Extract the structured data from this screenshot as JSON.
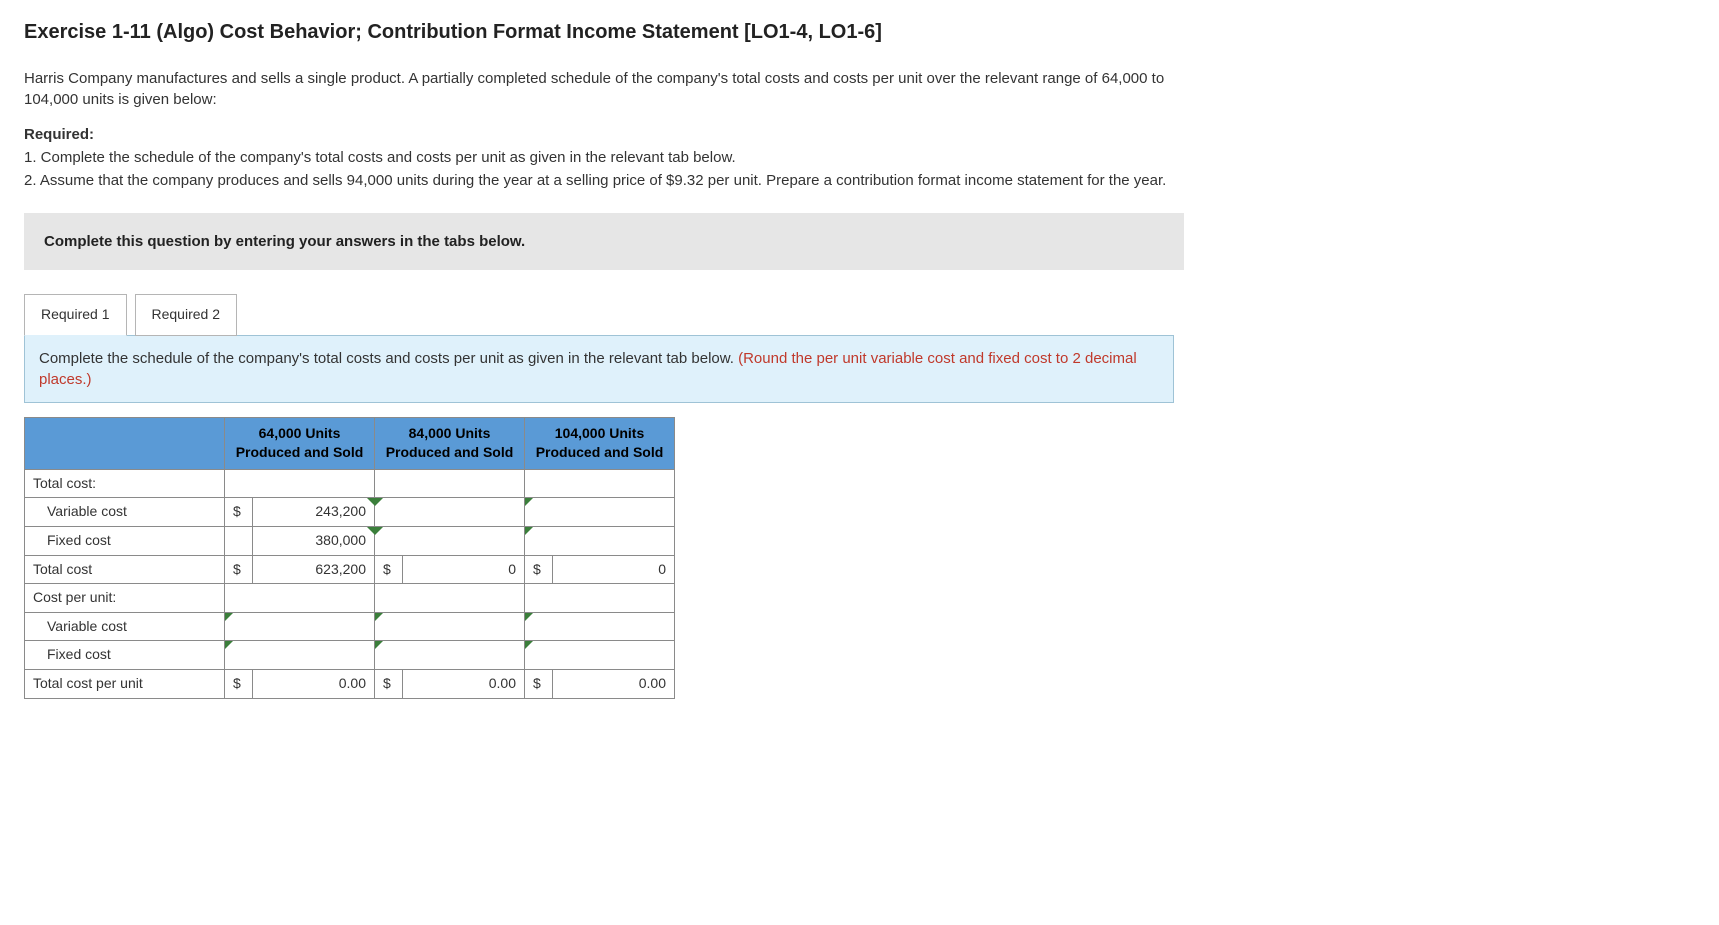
{
  "title": "Exercise 1-11 (Algo) Cost Behavior; Contribution Format Income Statement [LO1-4, LO1-6]",
  "intro": "Harris Company manufactures and sells a single product. A partially completed schedule of the company's total costs and costs per unit over the relevant range of 64,000 to 104,000 units is given below:",
  "required_label": "Required:",
  "requirements": [
    "1. Complete the schedule of the company's total costs and costs per unit as given in the relevant tab below.",
    "2. Assume that the company produces and sells 94,000 units during the year at a selling price of $9.32 per unit. Prepare a contribution format income statement for the year."
  ],
  "instruction_box": "Complete this question by entering your answers in the tabs below.",
  "tabs": {
    "t1": "Required 1",
    "t2": "Required 2"
  },
  "tab1_text_main": "Complete the schedule of the company's total costs and costs per unit as given in the relevant tab below. ",
  "tab1_text_hint": "(Round the per unit variable cost and fixed cost to 2 decimal places.)",
  "headers": {
    "c1": "64,000 Units Produced and Sold",
    "c2": "84,000 Units Produced and Sold",
    "c3": "104,000 Units Produced and Sold"
  },
  "rows": {
    "total_cost_label": "Total cost:",
    "variable_cost": "Variable cost",
    "fixed_cost": "Fixed cost",
    "total_cost": "Total cost",
    "cpu_label": "Cost per unit:",
    "cpu_variable": "Variable cost",
    "cpu_fixed": "Fixed cost",
    "cpu_total": "Total cost per unit"
  },
  "values": {
    "dollar": "$",
    "vc_64": "243,200",
    "fc_64": "380,000",
    "tc_64": "623,200",
    "tc_84": "0",
    "tc_104": "0",
    "cpu_64": "0.00",
    "cpu_84": "0.00",
    "cpu_104": "0.00"
  }
}
